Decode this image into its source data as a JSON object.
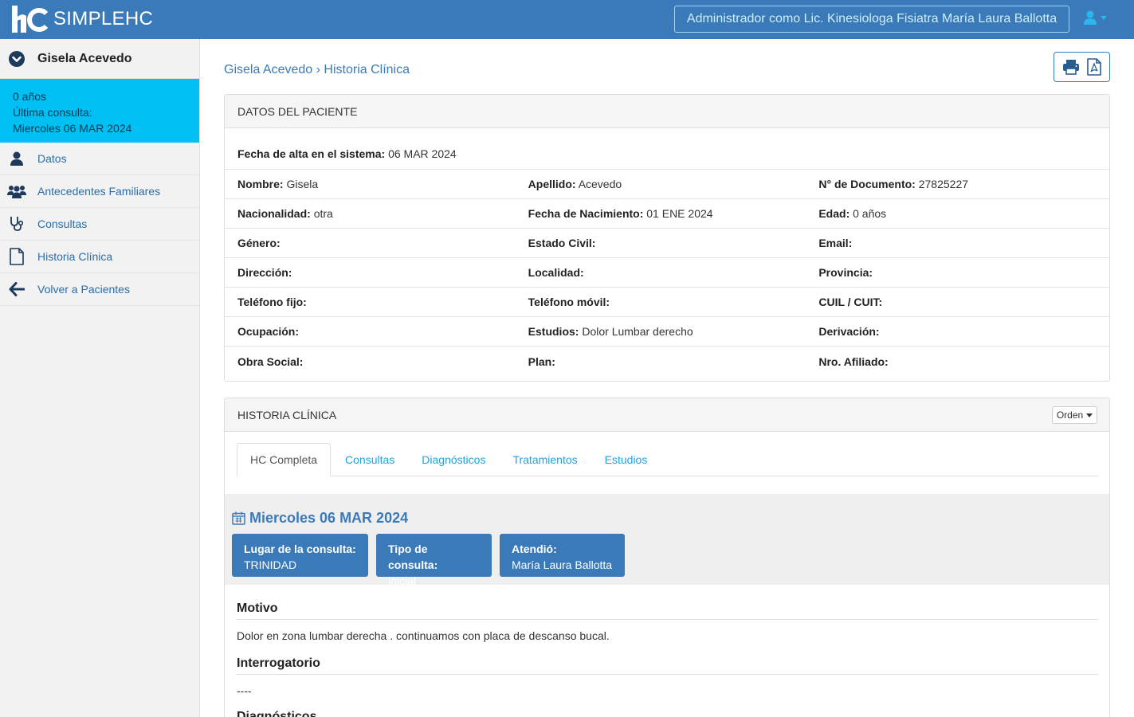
{
  "app": {
    "name": "SIMPLEHC",
    "brand_color": "#3a7ab8",
    "accent_color": "#00bff3"
  },
  "header": {
    "admin_label": "Administrador como Lic. Kinesiologa Fisiatra María Laura Ballotta"
  },
  "sidebar": {
    "patient_name": "Gisela Acevedo",
    "info": {
      "age": "0 años",
      "last_label": "Última consulta:",
      "last_date": "Miercoles 06 MAR 2024"
    },
    "items": [
      {
        "label": "Datos",
        "icon": "user-icon"
      },
      {
        "label": "Antecedentes Familiares",
        "icon": "users-icon"
      },
      {
        "label": "Consultas",
        "icon": "stethoscope-icon"
      },
      {
        "label": "Historia Clínica",
        "icon": "document-icon"
      },
      {
        "label": "Volver a Pacientes",
        "icon": "arrow-left-icon"
      }
    ]
  },
  "breadcrumb": {
    "patient": "Gisela Acevedo",
    "separator": "›",
    "page": "Historia Clínica"
  },
  "datos": {
    "heading": "DATOS DEL PACIENTE",
    "alta_label": "Fecha de alta en el sistema:",
    "alta_value": "06 MAR 2024",
    "rows": [
      [
        {
          "label": "Nombre:",
          "value": "Gisela"
        },
        {
          "label": "Apellido:",
          "value": "Acevedo"
        },
        {
          "label": "N° de Documento:",
          "value": "27825227"
        }
      ],
      [
        {
          "label": "Nacionalidad:",
          "value": "otra"
        },
        {
          "label": "Fecha de Nacimiento:",
          "value": "01 ENE 2024"
        },
        {
          "label": "Edad:",
          "value": "0 años"
        }
      ],
      [
        {
          "label": "Género:",
          "value": ""
        },
        {
          "label": "Estado Civil:",
          "value": ""
        },
        {
          "label": "Email:",
          "value": ""
        }
      ],
      [
        {
          "label": "Dirección:",
          "value": ""
        },
        {
          "label": "Localidad:",
          "value": ""
        },
        {
          "label": "Provincia:",
          "value": ""
        }
      ],
      [
        {
          "label": "Teléfono fijo:",
          "value": ""
        },
        {
          "label": "Teléfono móvil:",
          "value": ""
        },
        {
          "label": "CUIL / CUIT:",
          "value": ""
        }
      ],
      [
        {
          "label": "Ocupación:",
          "value": ""
        },
        {
          "label": "Estudios:",
          "value": "Dolor Lumbar derecho"
        },
        {
          "label": "Derivación:",
          "value": ""
        }
      ],
      [
        {
          "label": "Obra Social:",
          "value": ""
        },
        {
          "label": "Plan:",
          "value": ""
        },
        {
          "label": "Nro. Afiliado:",
          "value": ""
        }
      ]
    ]
  },
  "hc": {
    "heading": "HISTORIA CLÍNICA",
    "orden_label": "Orden",
    "tabs": [
      {
        "label": "HC Completa",
        "active": true
      },
      {
        "label": "Consultas",
        "active": false
      },
      {
        "label": "Diagnósticos",
        "active": false
      },
      {
        "label": "Tratamientos",
        "active": false
      },
      {
        "label": "Estudios",
        "active": false
      }
    ],
    "consulta": {
      "date": "Miercoles 06 MAR 2024",
      "chips": [
        {
          "label": "Lugar de la consulta:",
          "value": "TRINIDAD"
        },
        {
          "label": "Tipo de consulta:",
          "value": "inicial"
        },
        {
          "label": "Atendió:",
          "value": "María Laura Ballotta"
        }
      ]
    },
    "sections": [
      {
        "title": "Motivo",
        "text": "Dolor en zona lumbar derecha . continuamos con placa de descanso bucal."
      },
      {
        "title": "Interrogatorio",
        "text": "----"
      },
      {
        "title": "Diagnósticos",
        "text": ""
      }
    ]
  }
}
